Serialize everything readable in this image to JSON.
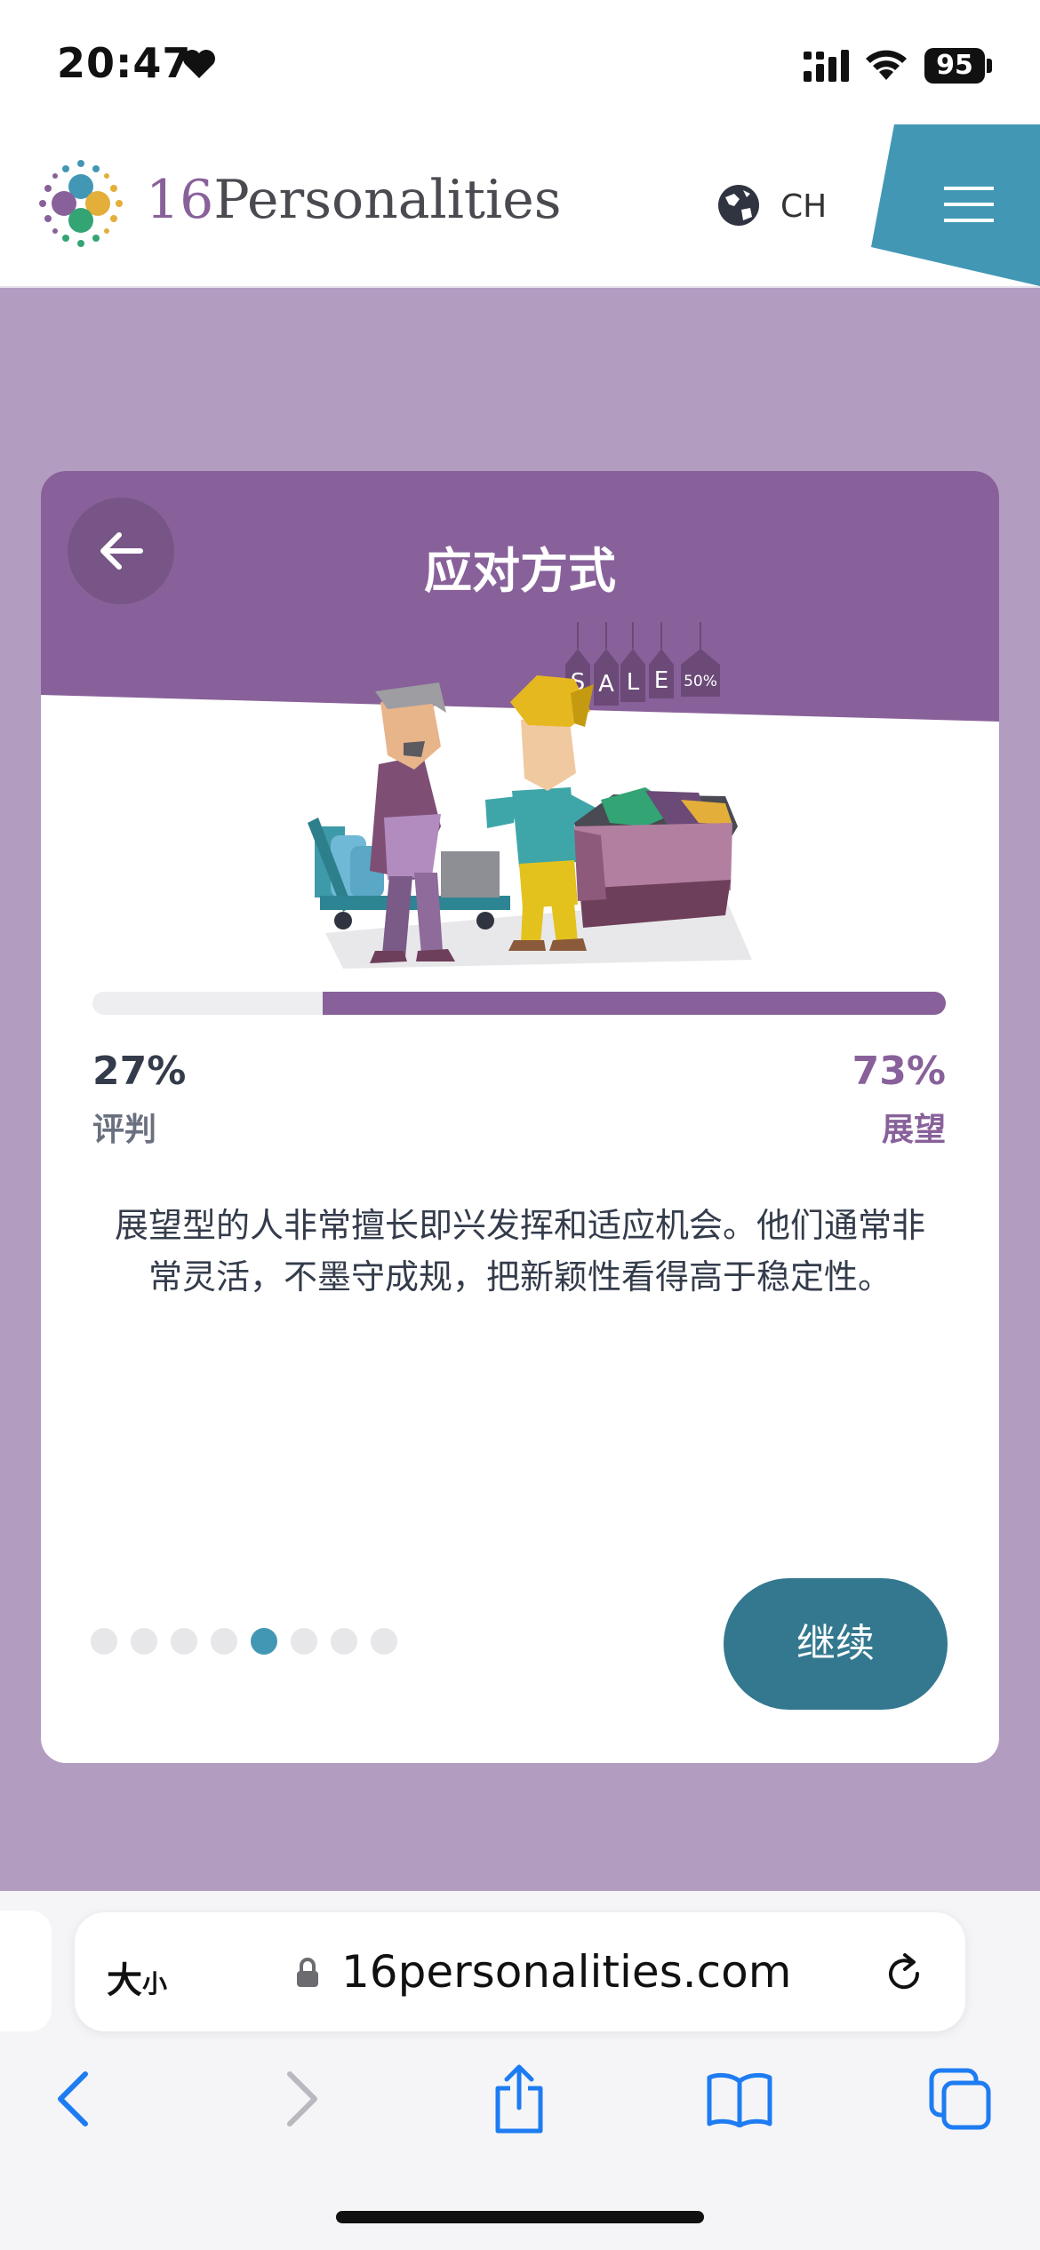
{
  "status": {
    "time": "20:47",
    "battery": "95"
  },
  "header": {
    "logo_number": "16",
    "logo_word": "Personalities",
    "language": "CH"
  },
  "card": {
    "title": "应对方式",
    "sale_sign": [
      "S",
      "A",
      "L",
      "E",
      "50%"
    ],
    "left_percent": "27%",
    "left_label": "评判",
    "right_percent": "73%",
    "right_label": "展望",
    "right_fraction": 0.73,
    "description": "展望型的人非常擅长即兴发挥和适应机会。他们通常非常灵活，不墨守成规，把新颖性看得高于稳定性。",
    "pagination_total": 8,
    "pagination_active": 5,
    "continue_label": "继续"
  },
  "browser": {
    "text_size_big": "大",
    "text_size_small": "小",
    "url": "16personalities.com"
  },
  "colors": {
    "page_bg": "#b29cc0",
    "accent_purple": "#88619a",
    "continue_teal": "#33788f",
    "menu_teal": "#4298b4",
    "active_dot": "#4298b4"
  }
}
